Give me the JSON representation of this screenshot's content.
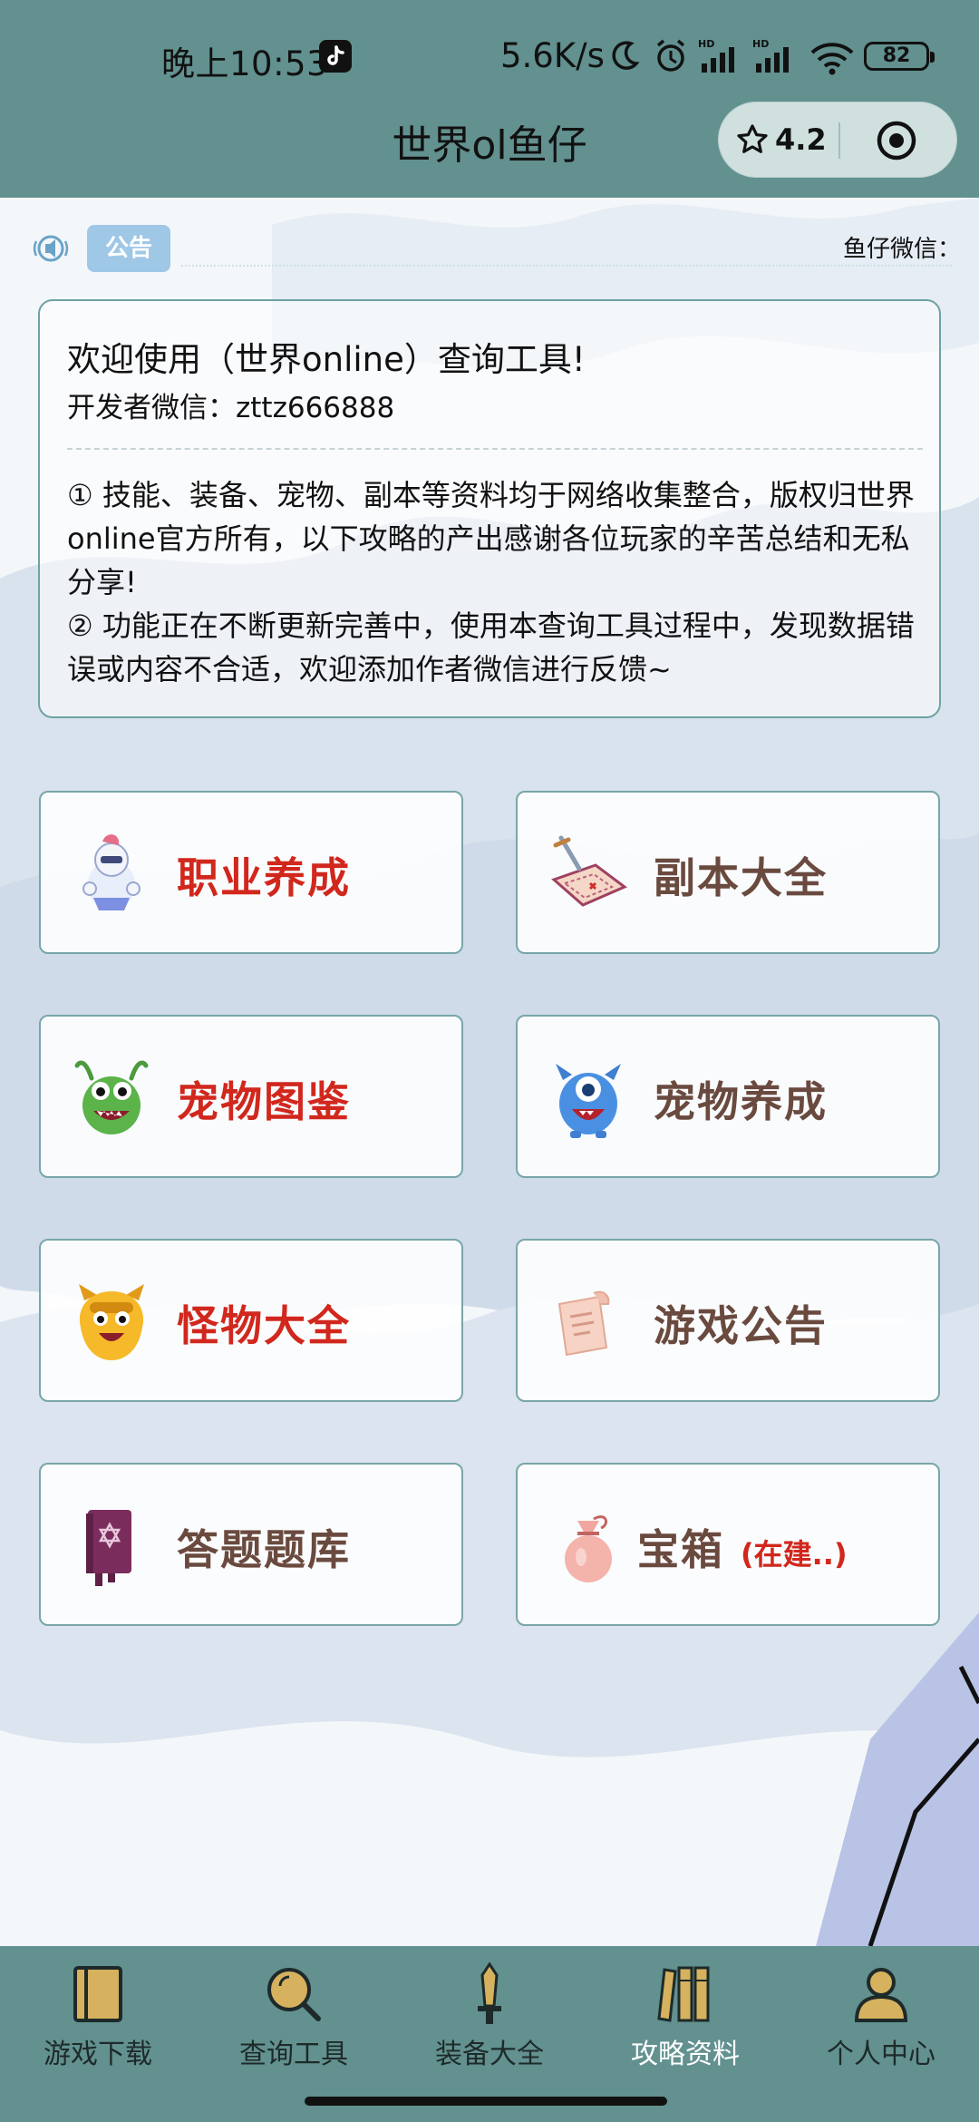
{
  "status_bar": {
    "time": "晚上10:53",
    "network_speed": "5.6K/s",
    "battery": "82"
  },
  "header": {
    "title": "世界ol鱼仔",
    "rating": "4.2"
  },
  "notice": {
    "tag": "公告",
    "scroll_text": "鱼仔微信："
  },
  "info_card": {
    "title": "欢迎使用（世界online）查询工具!",
    "developer": "开发者微信：zttz666888",
    "paragraphs": [
      "① 技能、装备、宠物、副本等资料均于网络收集整合，版权归世界online官方所有，以下攻略的产出感谢各位玩家的辛苦总结和无私分享!",
      "② 功能正在不断更新完善中，使用本查询工具过程中，发现数据错误或内容不合适，欢迎添加作者微信进行反馈~"
    ]
  },
  "menu": {
    "items": [
      {
        "label": "职业养成",
        "icon": "knight-icon"
      },
      {
        "label": "副本大全",
        "icon": "treasure-map-icon"
      },
      {
        "label": "宠物图鉴",
        "icon": "green-monster-icon"
      },
      {
        "label": "宠物养成",
        "icon": "blue-monster-icon"
      },
      {
        "label": "怪物大全",
        "icon": "yellow-monster-icon"
      },
      {
        "label": "游戏公告",
        "icon": "scroll-icon"
      },
      {
        "label": "答题题库",
        "icon": "book-icon"
      },
      {
        "label": "宝箱",
        "suffix": "(在建..)",
        "icon": "pouch-icon"
      }
    ]
  },
  "bottom_nav": {
    "items": [
      {
        "label": "游戏下载",
        "icon": "book-icon"
      },
      {
        "label": "查询工具",
        "icon": "search-icon"
      },
      {
        "label": "装备大全",
        "icon": "sword-icon"
      },
      {
        "label": "攻略资料",
        "icon": "library-icon",
        "active": true
      },
      {
        "label": "个人中心",
        "icon": "user-icon"
      }
    ]
  },
  "colors": {
    "header_bg": "#62918f",
    "accent_red": "#d1271d",
    "label_brown": "#6a4a3f",
    "tile_border": "#79a6a8"
  }
}
